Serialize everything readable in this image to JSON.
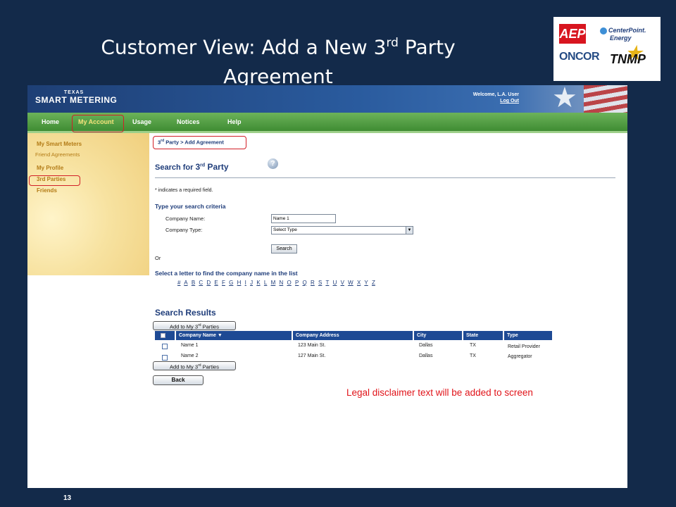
{
  "slide": {
    "title_line1_pre": "Customer View:  Add a New 3",
    "title_line1_sup": "rd",
    "title_line1_post": " Party",
    "title_line2": "Agreement",
    "page_number": "13"
  },
  "logos": {
    "aep": "AEP",
    "centerpoint_line1": "CenterPoint.",
    "centerpoint_line2": "Energy",
    "oncor": "ONCOR",
    "tnmp": "TNMP"
  },
  "app": {
    "brand_line1": "TEXAS",
    "brand_line2": "SMART METERING",
    "welcome": "Welcome, L.A. User",
    "logout": "Log Out"
  },
  "nav": {
    "items": [
      "Home",
      "My Account",
      "Usage",
      "Notices",
      "Help"
    ],
    "active": "My Account"
  },
  "sidebar": {
    "my_smart_meters": "My Smart Meters",
    "friend_agreements": "Friend Agreements",
    "my_profile": "My Profile",
    "third_parties": "3rd Parties",
    "friends": "Friends"
  },
  "breadcrumb": {
    "pre": "3",
    "sup": "rd",
    "post": " Party > Add Agreement"
  },
  "search": {
    "title_pre": "Search for ",
    "title_num": "3",
    "title_sup": "rd",
    "title_post": " Party",
    "required_note": "* indicates a required field.",
    "criteria_title": "Type your search criteria",
    "company_name_label": "Company Name:",
    "company_name_value": "Name 1",
    "company_type_label": "Company Type:",
    "company_type_value": "Select Type",
    "search_button": "Search",
    "or": "Or",
    "letters_title": "Select a letter to find the company name in the list",
    "letters": [
      "#",
      "A",
      "B",
      "C",
      "D",
      "E",
      "F",
      "G",
      "H",
      "I",
      "J",
      "K",
      "L",
      "M",
      "N",
      "O",
      "P",
      "Q",
      "R",
      "S",
      "T",
      "U",
      "V",
      "W",
      "X",
      "Y",
      "Z"
    ]
  },
  "results": {
    "title": "Search Results",
    "add_button_pre": "Add to My 3",
    "add_button_sup": "rd",
    "add_button_post": " Parties",
    "columns": [
      "Company Name ▼",
      "Company Address",
      "City",
      "State",
      "Type"
    ],
    "rows": [
      {
        "name": "Name 1",
        "address": "123 Main St.",
        "city": "Dallas",
        "state": "TX",
        "type": "Retail Provider"
      },
      {
        "name": "Name 2",
        "address": "127 Main St.",
        "city": "Dallas",
        "state": "TX",
        "type": "Aggregator"
      }
    ],
    "back_button": "Back"
  },
  "disclaimer": "Legal disclaimer text will be added to screen",
  "colors": {
    "slide_bg": "#132a4a",
    "header_blue": "#1e4a94",
    "nav_green": "#3f8c33",
    "highlight_red": "#d21f27",
    "disclaimer_red": "#e1141a"
  }
}
